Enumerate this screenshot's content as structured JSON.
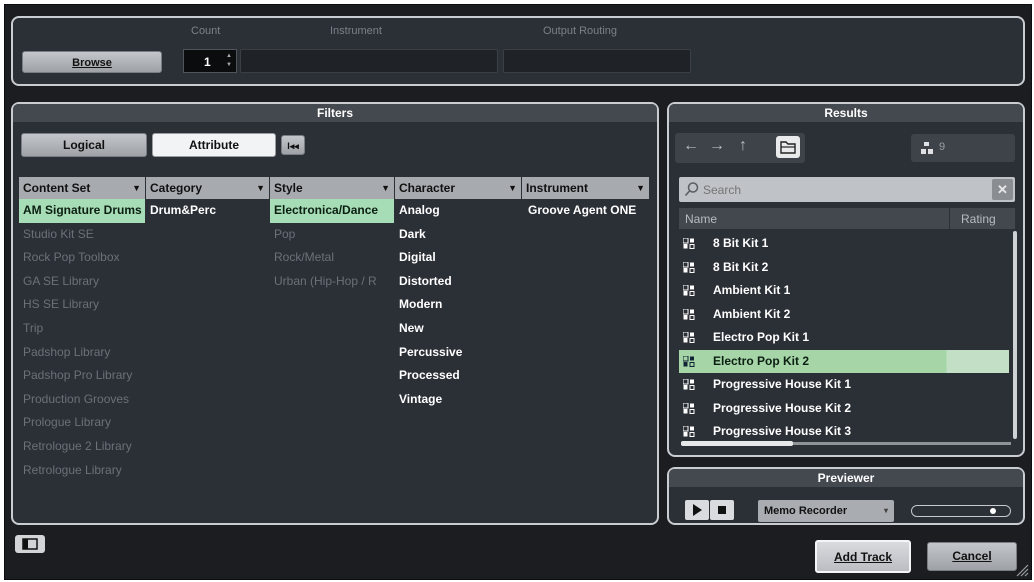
{
  "top": {
    "browse_label": "Browse",
    "count_label": "Count",
    "instrument_label": "Instrument",
    "output_routing_label": "Output Routing",
    "count_value": "1"
  },
  "filters": {
    "title": "Filters",
    "logical_label": "Logical",
    "attribute_label": "Attribute",
    "columns": [
      {
        "header": "Content Set",
        "items": [
          {
            "label": "AM Signature Drums",
            "state": "sel"
          },
          {
            "label": "Studio Kit SE",
            "state": "dim"
          },
          {
            "label": "Rock Pop Toolbox",
            "state": "dim"
          },
          {
            "label": "GA SE Library",
            "state": "dim"
          },
          {
            "label": "HS SE Library",
            "state": "dim"
          },
          {
            "label": "Trip",
            "state": "dim"
          },
          {
            "label": "Padshop Library",
            "state": "dim"
          },
          {
            "label": "Padshop Pro Library",
            "state": "dim"
          },
          {
            "label": "Production Grooves",
            "state": "dim"
          },
          {
            "label": "Prologue Library",
            "state": "dim"
          },
          {
            "label": "Retrologue 2 Library",
            "state": "dim"
          },
          {
            "label": "Retrologue Library",
            "state": "dim"
          }
        ]
      },
      {
        "header": "Category",
        "items": [
          {
            "label": "Drum&Perc",
            "state": "bold"
          }
        ]
      },
      {
        "header": "Style",
        "items": [
          {
            "label": "Electronica/Dance",
            "state": "sel"
          },
          {
            "label": "Pop",
            "state": "dim"
          },
          {
            "label": "Rock/Metal",
            "state": "dim"
          },
          {
            "label": "Urban (Hip-Hop / R",
            "state": "dim"
          }
        ]
      },
      {
        "header": "Character",
        "items": [
          {
            "label": "Analog",
            "state": "bold"
          },
          {
            "label": "Dark",
            "state": "bold"
          },
          {
            "label": "Digital",
            "state": "bold"
          },
          {
            "label": "Distorted",
            "state": "bold"
          },
          {
            "label": "Modern",
            "state": "bold"
          },
          {
            "label": "New",
            "state": "bold"
          },
          {
            "label": "Percussive",
            "state": "bold"
          },
          {
            "label": "Processed",
            "state": "bold"
          },
          {
            "label": "Vintage",
            "state": "bold"
          }
        ]
      },
      {
        "header": "Instrument",
        "items": [
          {
            "label": "Groove Agent ONE",
            "state": "bold"
          }
        ]
      }
    ]
  },
  "results": {
    "title": "Results",
    "count": "9",
    "search_placeholder": "Search",
    "col_name": "Name",
    "col_rating": "Rating",
    "rows": [
      {
        "label": "8 Bit Kit 1",
        "selected": false
      },
      {
        "label": "8 Bit Kit 2",
        "selected": false
      },
      {
        "label": "Ambient Kit 1",
        "selected": false
      },
      {
        "label": "Ambient Kit 2",
        "selected": false
      },
      {
        "label": "Electro Pop Kit 1",
        "selected": false
      },
      {
        "label": "Electro Pop Kit 2",
        "selected": true
      },
      {
        "label": "Progressive House Kit 1",
        "selected": false
      },
      {
        "label": "Progressive House Kit 2",
        "selected": false
      },
      {
        "label": "Progressive House Kit 3",
        "selected": false
      }
    ]
  },
  "previewer": {
    "title": "Previewer",
    "source": "Memo Recorder"
  },
  "footer": {
    "add_track_label": "Add Track",
    "cancel_label": "Cancel"
  },
  "icons": {
    "back": "arrow-left-icon",
    "forward": "arrow-right-icon",
    "up": "arrow-up-icon",
    "folder": "folder-icon",
    "kit": "drum-kit-icon",
    "reset": "reset-filters-icon"
  }
}
